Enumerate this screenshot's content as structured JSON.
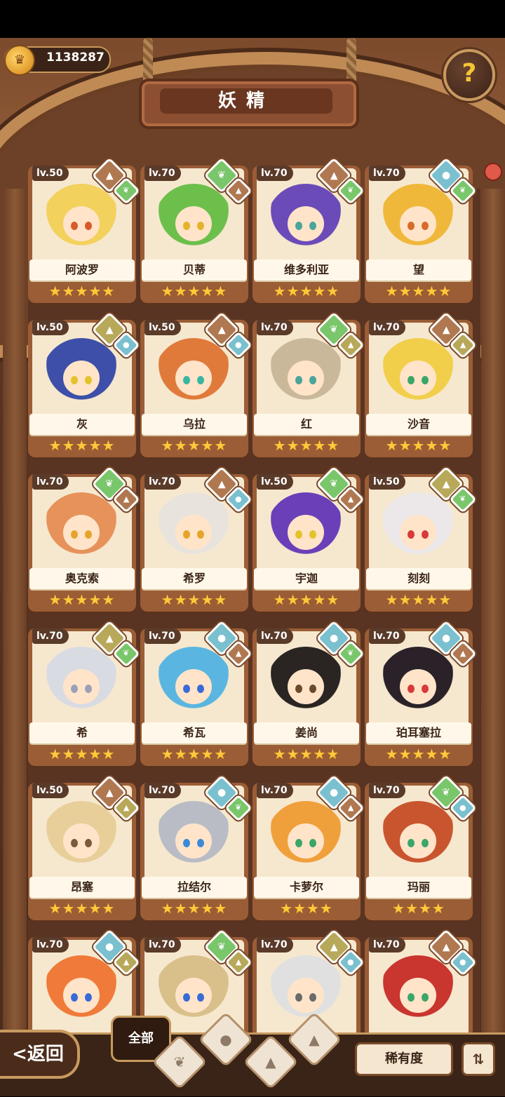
{
  "header": {
    "currency_value": "1138287",
    "title": "妖精",
    "help_icon": "question-icon"
  },
  "colors": {
    "fire": "#b07850",
    "wind": "#7ac66b",
    "water": "#7ac0cf",
    "earth": "#b8a85a",
    "frame": "#8a5634"
  },
  "cards": [
    {
      "lv": "lv.50",
      "name": "阿波罗",
      "stars": 5,
      "hair": "#f2d15d",
      "eyes": "#d85a2a",
      "elem1": "fire",
      "elem2": "wind"
    },
    {
      "lv": "lv.70",
      "name": "贝蒂",
      "stars": 5,
      "hair": "#6dbf4b",
      "eyes": "#e5b32a",
      "elem1": "wind",
      "elem2": "fire"
    },
    {
      "lv": "lv.70",
      "name": "维多利亚",
      "stars": 5,
      "hair": "#6b4bb8",
      "eyes": "#4aa59a",
      "elem1": "fire",
      "elem2": "wind"
    },
    {
      "lv": "lv.70",
      "name": "望",
      "stars": 5,
      "hair": "#f0b83a",
      "eyes": "#d86a2a",
      "elem1": "water",
      "elem2": "wind"
    },
    {
      "lv": "lv.50",
      "name": "灰",
      "stars": 5,
      "hair": "#3d4fa8",
      "eyes": "#e5c22a",
      "elem1": "earth",
      "elem2": "water"
    },
    {
      "lv": "lv.50",
      "name": "乌拉",
      "stars": 5,
      "hair": "#e07a3a",
      "eyes": "#3ab6a0",
      "elem1": "fire",
      "elem2": "water"
    },
    {
      "lv": "lv.70",
      "name": "红",
      "stars": 5,
      "hair": "#c9b99a",
      "eyes": "#4aa59a",
      "elem1": "wind",
      "elem2": "earth"
    },
    {
      "lv": "lv.70",
      "name": "沙音",
      "stars": 5,
      "hair": "#f2cf4a",
      "eyes": "#3aa66a",
      "elem1": "fire",
      "elem2": "earth"
    },
    {
      "lv": "lv.70",
      "name": "奥克索",
      "stars": 5,
      "hair": "#e6925a",
      "eyes": "#e5a52a",
      "elem1": "wind",
      "elem2": "fire"
    },
    {
      "lv": "lv.70",
      "name": "希罗",
      "stars": 5,
      "hair": "#e8e3dc",
      "eyes": "#e5a52a",
      "elem1": "fire",
      "elem2": "water"
    },
    {
      "lv": "lv.50",
      "name": "宇迦",
      "stars": 5,
      "hair": "#6a3fb8",
      "eyes": "#e5c22a",
      "elem1": "wind",
      "elem2": "fire"
    },
    {
      "lv": "lv.50",
      "name": "刻刻",
      "stars": 5,
      "hair": "#ece8ea",
      "eyes": "#d83a3a",
      "elem1": "earth",
      "elem2": "wind"
    },
    {
      "lv": "lv.70",
      "name": "希",
      "stars": 5,
      "hair": "#d9dbe2",
      "eyes": "#9aa0b8",
      "elem1": "earth",
      "elem2": "wind"
    },
    {
      "lv": "lv.70",
      "name": "希瓦",
      "stars": 5,
      "hair": "#5ab6e0",
      "eyes": "#3a6ad8",
      "elem1": "water",
      "elem2": "fire"
    },
    {
      "lv": "lv.70",
      "name": "姜尚",
      "stars": 5,
      "hair": "#2a2522",
      "eyes": "#6a4a2a",
      "elem1": "water",
      "elem2": "wind"
    },
    {
      "lv": "lv.70",
      "name": "珀耳塞拉",
      "stars": 5,
      "hair": "#2a2228",
      "eyes": "#d83a3a",
      "elem1": "water",
      "elem2": "fire"
    },
    {
      "lv": "lv.50",
      "name": "昂塞",
      "stars": 5,
      "hair": "#e8cf9a",
      "eyes": "#7a5a3a",
      "elem1": "fire",
      "elem2": "earth"
    },
    {
      "lv": "lv.70",
      "name": "拉结尔",
      "stars": 5,
      "hair": "#b9bcc4",
      "eyes": "#3a8ad8",
      "elem1": "water",
      "elem2": "wind"
    },
    {
      "lv": "lv.70",
      "name": "卡萝尔",
      "stars": 4,
      "hair": "#f0a03a",
      "eyes": "#3aa66a",
      "elem1": "water",
      "elem2": "fire"
    },
    {
      "lv": "lv.70",
      "name": "玛丽",
      "stars": 4,
      "hair": "#c9552f",
      "eyes": "#3aa66a",
      "elem1": "wind",
      "elem2": "water"
    },
    {
      "lv": "lv.70",
      "name": "",
      "stars": 0,
      "hair": "#f07a3a",
      "eyes": "#3a6ad8",
      "elem1": "water",
      "elem2": "earth"
    },
    {
      "lv": "lv.70",
      "name": "",
      "stars": 0,
      "hair": "#d9c08a",
      "eyes": "#3a6ad8",
      "elem1": "wind",
      "elem2": "earth"
    },
    {
      "lv": "lv.70",
      "name": "",
      "stars": 0,
      "hair": "#e0e0e0",
      "eyes": "#6a6a6a",
      "elem1": "earth",
      "elem2": "water"
    },
    {
      "lv": "lv.70",
      "name": "",
      "stars": 0,
      "hair": "#c9352f",
      "eyes": "#3aa66a",
      "elem1": "fire",
      "elem2": "water"
    }
  ],
  "bottom": {
    "back_label": "返回",
    "filter_all_label": "全部",
    "rarity_label": "稀有度",
    "sort_icon": "sort-icon"
  }
}
